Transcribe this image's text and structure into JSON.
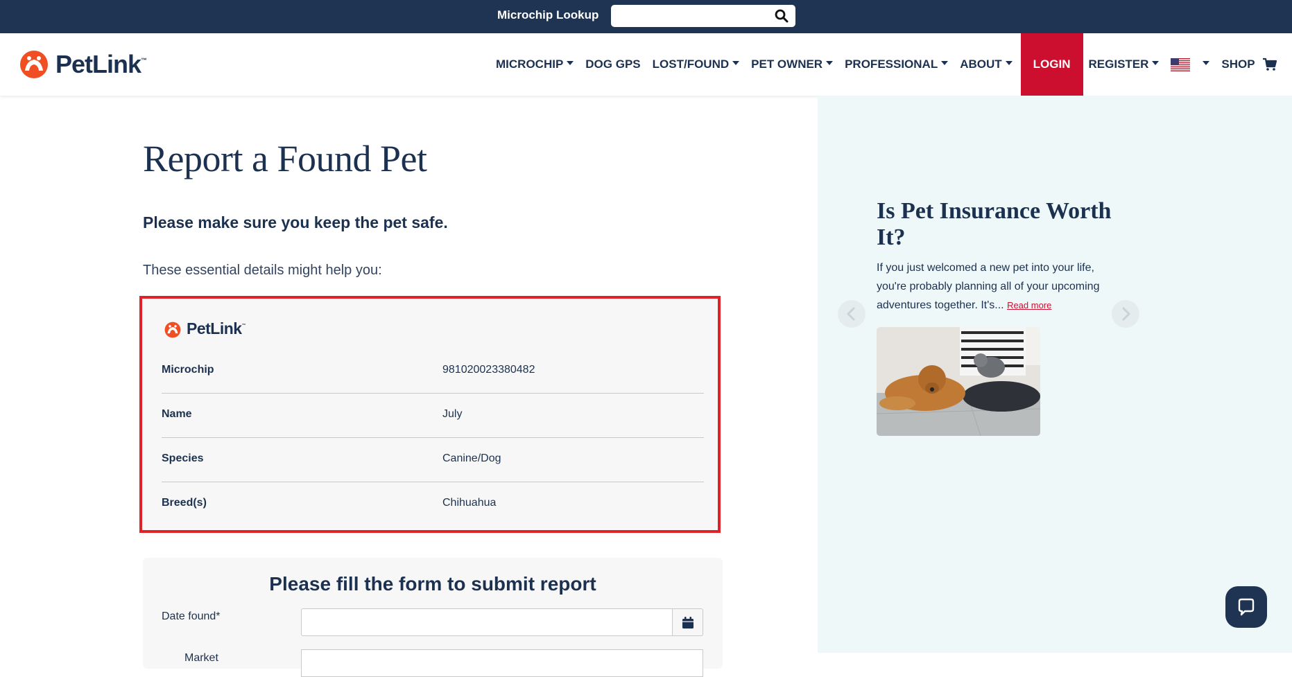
{
  "topbar": {
    "lookup_label": "Microchip Lookup",
    "lookup_value": "",
    "search_icon": "search-icon"
  },
  "header": {
    "logo_text": "PetLink",
    "logo_tm": "™",
    "nav": {
      "microchip": "MICROCHIP",
      "dog_gps": "DOG GPS",
      "lost_found": "LOST/FOUND",
      "pet_owner": "PET OWNER",
      "professional": "PROFESSIONAL",
      "about": "ABOUT",
      "login": "LOGIN",
      "register": "REGISTER",
      "shop": "SHOP"
    }
  },
  "main": {
    "title": "Report a Found Pet",
    "subtitle": "Please make sure you keep the pet safe.",
    "hint": "These essential details might help you:",
    "card": {
      "logo_text": "PetLink",
      "logo_tm": "™",
      "rows": [
        {
          "label": "Microchip",
          "value": "981020023380482"
        },
        {
          "label": "Name",
          "value": "July"
        },
        {
          "label": "Species",
          "value": "Canine/Dog"
        },
        {
          "label": "Breed(s)",
          "value": "Chihuahua"
        }
      ]
    },
    "form": {
      "title": "Please fill the form to submit report",
      "date_label": "Date found*",
      "date_value": "",
      "next_label": "Market"
    }
  },
  "promo": {
    "title": "Is Pet Insurance Worth It?",
    "text": "If you just welcomed a new pet into your life, you're probably planning all of your upcoming adventures together. It's...",
    "read_more": "Read more"
  },
  "colors": {
    "navy": "#1f3452",
    "brand_red": "#cc0f2f",
    "highlight_red": "#e02128",
    "panel_bg": "#eef8f9",
    "logo_orange": "#f04e23"
  }
}
